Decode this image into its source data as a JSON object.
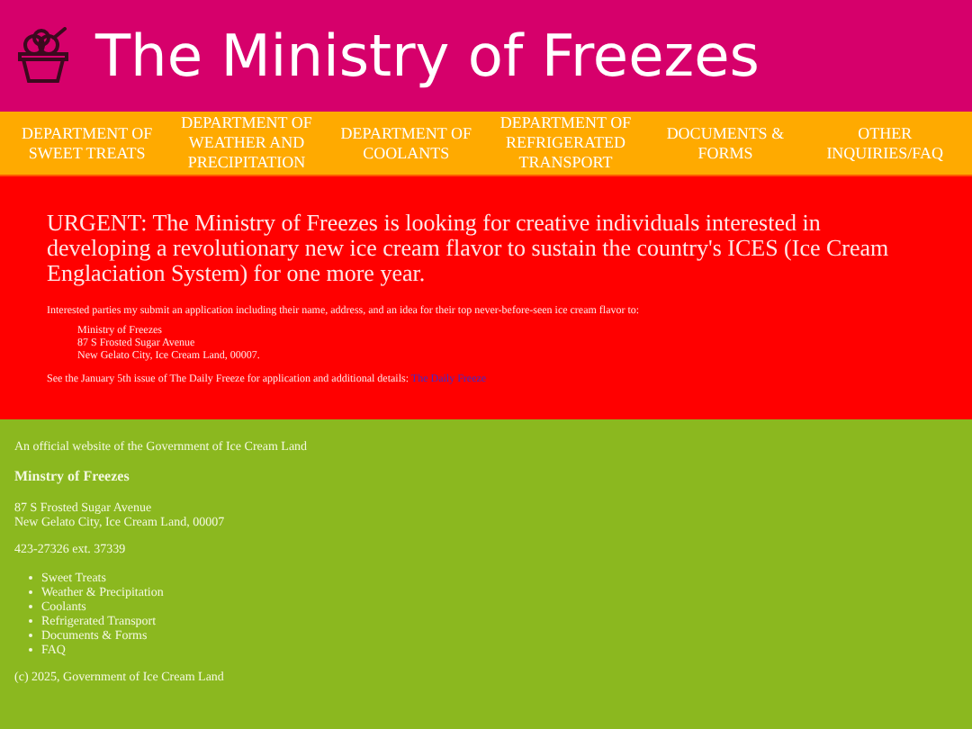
{
  "header": {
    "title": "The Ministry of Freezes"
  },
  "nav": [
    "DEPARTMENT OF SWEET TREATS",
    "DEPARTMENT OF WEATHER AND PRECIPITATION",
    "DEPARTMENT OF COOLANTS",
    "DEPARTMENT OF REFRIGERATED TRANSPORT",
    "DOCUMENTS & FORMS",
    "OTHER INQUIRIES/FAQ"
  ],
  "notice": {
    "headline": "URGENT: The Ministry of Freezes is looking for creative individuals interested in developing a revolutionary new ice cream flavor to sustain the country's ICES (Ice Cream Englaciation System) for one more year.",
    "intro": "Interested parties my submit an application including their name, address, and an idea for their top never-before-seen ice cream flavor to:",
    "address": [
      "Ministry of Freezes",
      "87 S Frosted Sugar Avenue",
      "New Gelato City, Ice Cream Land, 00007."
    ],
    "more": "See the January 5th issue of The Daily Freeze for application and additional details:",
    "link": "The Daily Freeze"
  },
  "footer": {
    "tagline": "An official website of the Government of Ice Cream Land",
    "name": "Minstry of Freezes",
    "address": [
      "87 S Frosted Sugar Avenue",
      "New Gelato City, Ice Cream Land, 00007"
    ],
    "phone": "423-27326 ext. 37339",
    "links": [
      "Sweet Treats",
      "Weather & Precipitation",
      "Coolants",
      "Refrigerated Transport",
      "Documents & Forms",
      "FAQ"
    ],
    "copyright": "(c) 2025, Government of Ice Cream Land"
  }
}
